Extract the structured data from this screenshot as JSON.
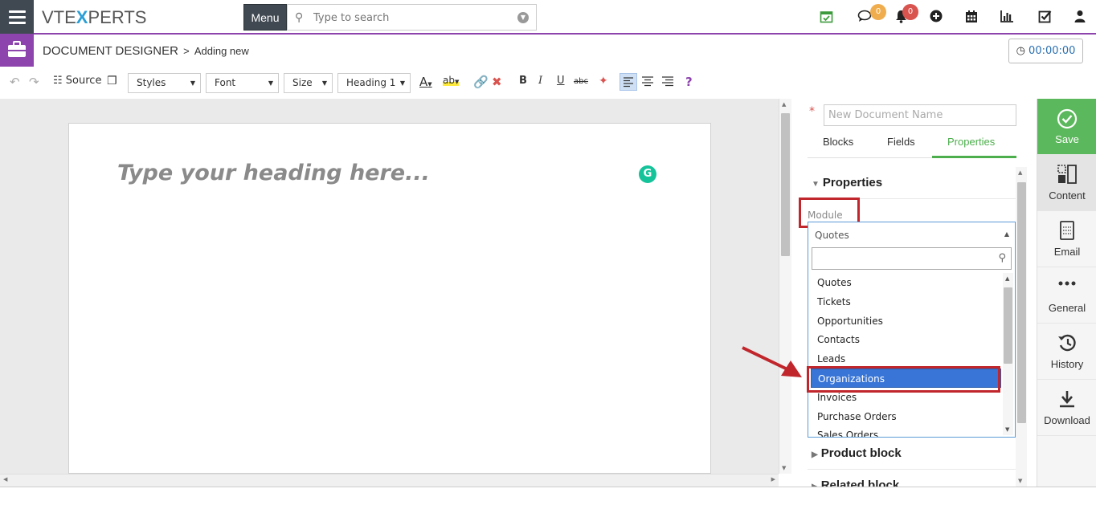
{
  "topbar": {
    "logo_left": "VTE",
    "logo_x": "X",
    "logo_right": "PERTS",
    "menu_label": "Menu",
    "search_placeholder": "Type to search",
    "chat_badge": "0",
    "notif_badge": "0"
  },
  "header": {
    "module": "DOCUMENT DESIGNER",
    "separator": ">",
    "subtitle": "Adding new",
    "timer": "00:00:00"
  },
  "toolbar": {
    "source_label": "Source",
    "styles_label": "Styles",
    "font_label": "Font",
    "size_label": "Size",
    "format_label": "Heading 1",
    "bold": "B",
    "italic": "I",
    "underline": "U",
    "strike": "abc",
    "help": "?"
  },
  "editor": {
    "heading_placeholder": "Type your heading here..."
  },
  "panel": {
    "required_mark": "*",
    "doc_name_placeholder": "New Document Name",
    "tabs": [
      "Blocks",
      "Fields",
      "Properties"
    ],
    "active_tab": "Properties",
    "properties_heading": "Properties",
    "module_label": "Module",
    "module_selected": "Quotes",
    "module_options": [
      "Quotes",
      "Tickets",
      "Opportunities",
      "Contacts",
      "Leads",
      "Organizations",
      "Invoices",
      "Purchase Orders",
      "Sales Orders"
    ],
    "highlighted_option": "Organizations",
    "product_block": "Product block",
    "related_block": "Related block"
  },
  "actions": [
    {
      "label": "Save",
      "icon": "check-circle-icon"
    },
    {
      "label": "Content",
      "icon": "content-icon"
    },
    {
      "label": "Email",
      "icon": "email-icon"
    },
    {
      "label": "General",
      "icon": "more-dots-icon"
    },
    {
      "label": "History",
      "icon": "history-icon"
    },
    {
      "label": "Download",
      "icon": "download-icon"
    }
  ],
  "colors": {
    "nav_dark": "#404952",
    "module_purple": "#8e44ad",
    "save_green": "#5cb85c",
    "selection_blue": "#3875d7",
    "annotation_red": "#c0262c",
    "badge_orange": "#f0ad4e",
    "badge_red": "#d9534f"
  }
}
